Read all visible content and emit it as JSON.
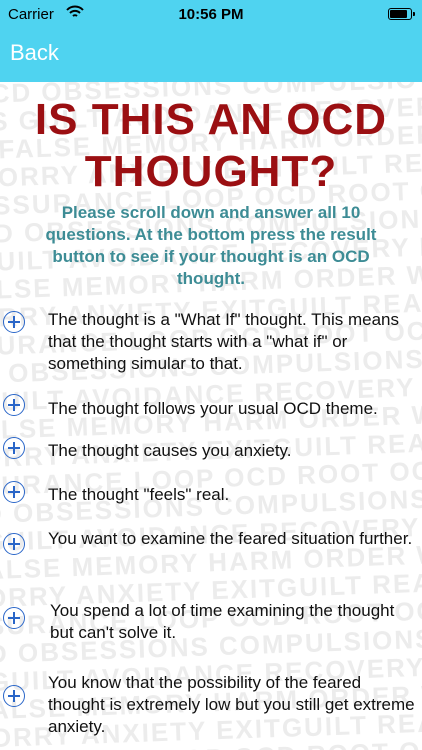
{
  "status": {
    "carrier": "Carrier",
    "time": "10:56 PM",
    "battery_level": 0.9
  },
  "nav": {
    "back_label": "Back"
  },
  "page": {
    "title_line1": "IS THIS AN OCD",
    "title_line2": "THOUGHT?",
    "instructions": "Please scroll down and answer all 10 questions. At the bottom press the result button to see if your thought is an OCD thought."
  },
  "questions": [
    "The thought is a \"What If\" thought. This means that the thought starts with a \"what if\" or something simular to that.",
    "The thought follows your usual OCD theme.",
    "The thought causes you anxiety.",
    "The thought \"feels\" real.",
    "You want to examine the feared situation further.",
    "You spend a lot of time examining the thought but can't solve it.",
    "You know that the possibility of the feared thought is extremely low but you still get extreme anxiety."
  ],
  "colors": {
    "accent": "#4fd3f0",
    "title": "#9b0f12",
    "instructions": "#3d8c95",
    "icon": "#2a66c8"
  },
  "icons": {
    "expand": "plus-circle-icon",
    "wifi": "wifi-icon",
    "battery": "battery-icon"
  },
  "background_text": "OCD OBSESSIONS COMPULSIONS GUILT AVOIDANCE RECOVERY FALSE MEMORY HARM ORDER WORRY ANXIETY EXITGUILT REASSURANCE LOOP OCD ROOT"
}
